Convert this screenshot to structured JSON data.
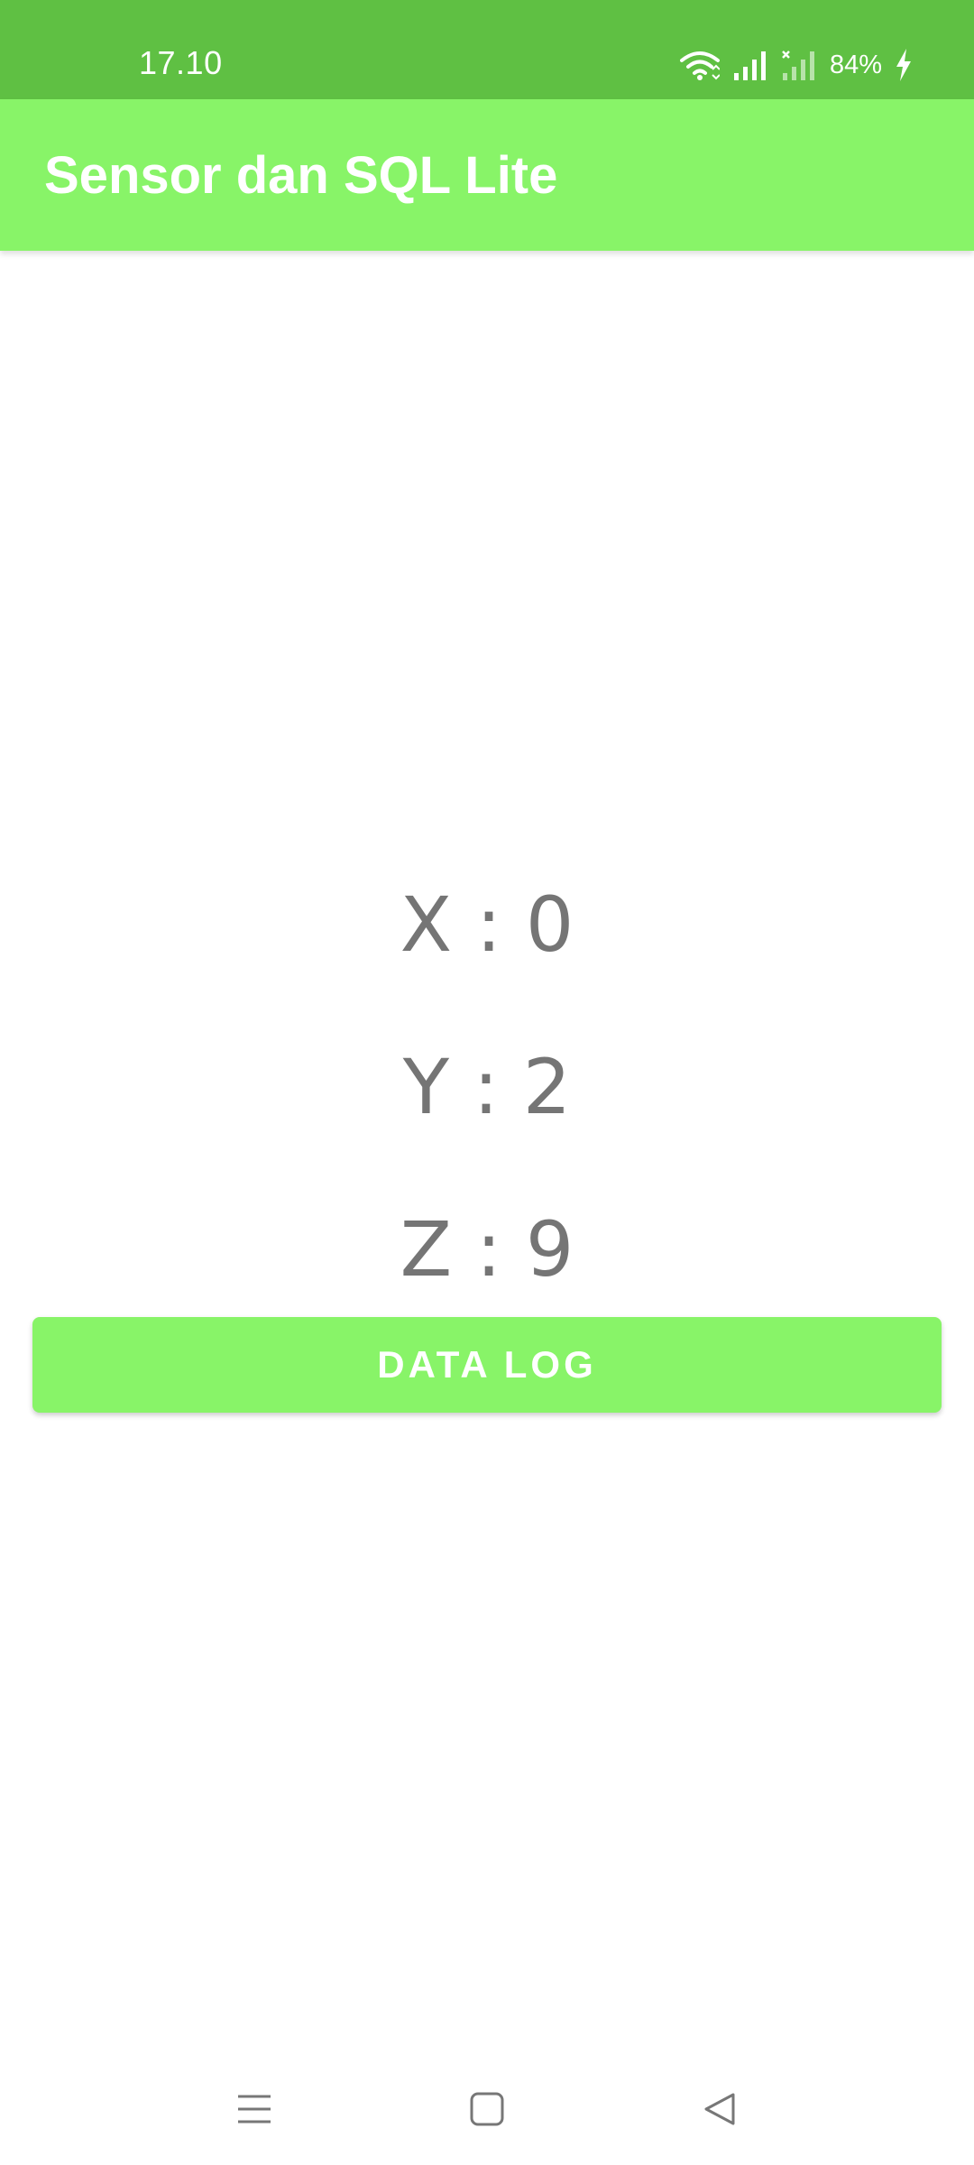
{
  "status_bar": {
    "time": "17.10",
    "battery_text": "84%",
    "icons": [
      "wifi-icon",
      "signal-icon",
      "no-signal-icon",
      "charging-icon"
    ]
  },
  "app_bar": {
    "title": "Sensor dan SQL Lite",
    "background": "#88f468"
  },
  "sensor": {
    "x_label": "X : 0",
    "y_label": "Y : 2",
    "z_label": "Z : 9"
  },
  "button": {
    "label": "DATA LOG",
    "background": "#88f468"
  },
  "nav_bar": {
    "icons": [
      "menu-icon",
      "home-icon",
      "back-icon"
    ]
  },
  "colors": {
    "status_bar": "#5fc043",
    "accent": "#88f468",
    "sensor_text": "#757575"
  }
}
